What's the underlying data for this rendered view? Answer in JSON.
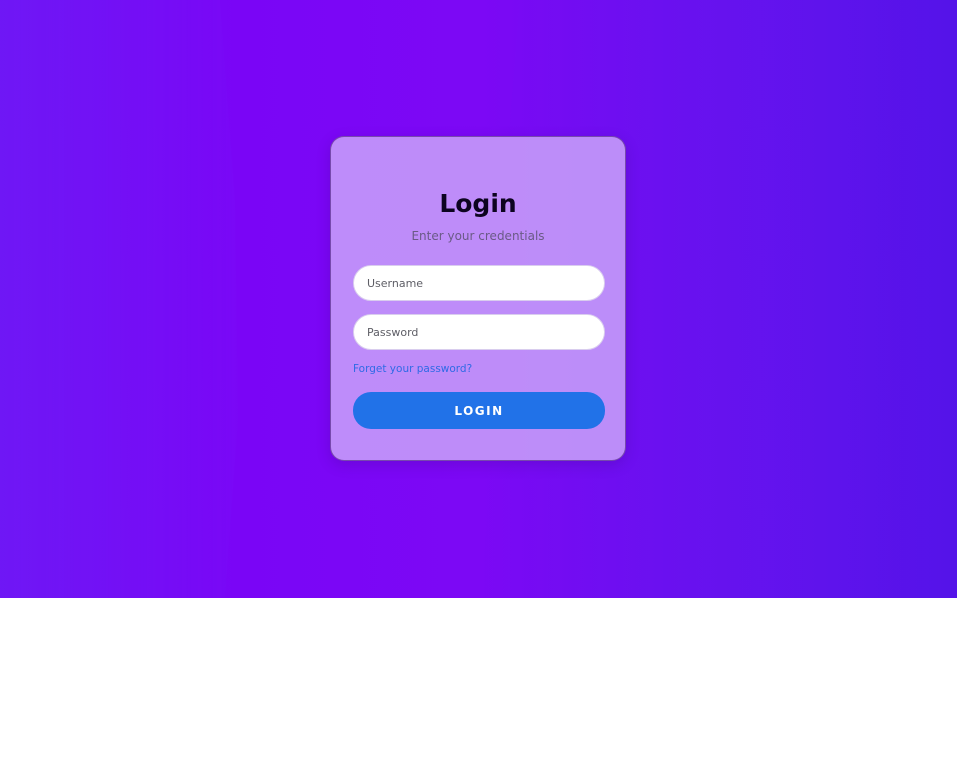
{
  "login_card": {
    "title": "Login",
    "subtitle": "Enter your credentials",
    "username": {
      "placeholder": "Username",
      "value": ""
    },
    "password": {
      "placeholder": "Password",
      "value": ""
    },
    "forgot_link": "Forget your password?",
    "login_button": "LOGIN"
  },
  "colors": {
    "background_gradient": [
      "#6a0ef0",
      "#7c08f5",
      "#5c12ea"
    ],
    "card_fill": "#cdaafa",
    "button": "#2172e8",
    "link": "#2f6ae6",
    "title": "#0d0420",
    "subtitle": "#6a5a86"
  }
}
